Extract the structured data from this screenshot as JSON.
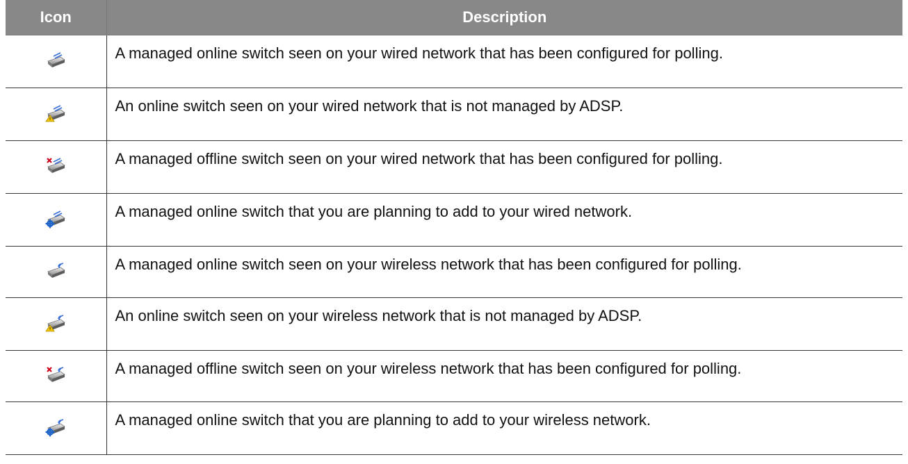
{
  "header": {
    "icon_label": "Icon",
    "description_label": "Description"
  },
  "rows": [
    {
      "icon": "wired-switch-managed-online-icon",
      "description": "A managed online switch seen on your wired network that has been configured for polling."
    },
    {
      "icon": "wired-switch-unmanaged-warning-icon",
      "description": "An online switch seen on your wired network that is not managed by ADSP."
    },
    {
      "icon": "wired-switch-offline-icon",
      "description": "A managed offline switch seen on your wired network that has been configured for polling."
    },
    {
      "icon": "wired-switch-planned-icon",
      "description": "A managed online switch that you are planning to add to your wired network."
    },
    {
      "icon": "wireless-switch-managed-online-icon",
      "description": "A managed online switch seen on your wireless network that has been configured for polling."
    },
    {
      "icon": "wireless-switch-unmanaged-warning-icon",
      "description": "An online switch seen on your wireless network that is not managed by ADSP."
    },
    {
      "icon": "wireless-switch-offline-icon",
      "description": "A managed offline switch seen on your wireless network that has been configured for polling."
    },
    {
      "icon": "wireless-switch-planned-icon",
      "description": "A managed online switch that you are planning to add to your wireless network."
    }
  ],
  "colors": {
    "header_bg": "#888888",
    "header_text": "#ffffff",
    "warning": "#f5c400",
    "offline": "#d0021b",
    "planned": "#1f64c8"
  }
}
